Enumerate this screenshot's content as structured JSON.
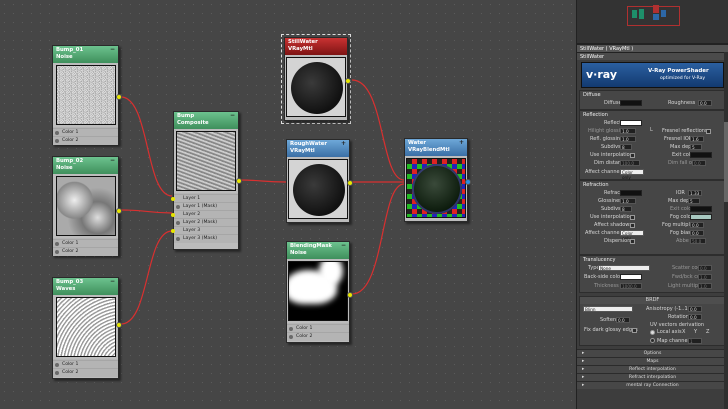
{
  "editor": {
    "nodes": {
      "bump01": {
        "title_line1": "Bump_01",
        "title_line2": "Noise",
        "slots": [
          "Color 1",
          "Color 2"
        ]
      },
      "bump02": {
        "title_line1": "Bump_02",
        "title_line2": "Noise",
        "slots": [
          "Color 1",
          "Color 2"
        ]
      },
      "bump03": {
        "title_line1": "Bump_03",
        "title_line2": "Waves",
        "slots": [
          "Color 1",
          "Color 2"
        ]
      },
      "composite": {
        "title_line1": "Bump",
        "title_line2": "Composite",
        "slots": [
          "Layer 1",
          "Layer 1 (Mask)",
          "Layer 2",
          "Layer 2 (Mask)",
          "Layer 3",
          "Layer 3 (Mask)"
        ]
      },
      "still": {
        "title_line1": "StillWater",
        "title_line2": "VRayMtl"
      },
      "rough": {
        "title_line1": "RoughWater",
        "title_line2": "VRayMtl"
      },
      "mask": {
        "title_line1": "BlendingMask",
        "title_line2": "Noise",
        "slots": [
          "Color 1",
          "Color 2"
        ]
      },
      "water": {
        "title_line1": "Water",
        "title_line2": "VRayBlendMtl"
      }
    },
    "toggle_glyph": "−"
  },
  "panel": {
    "title": "StillWater  ( VRayMtl )",
    "subtitle": "StillWater",
    "vray": {
      "logo": "v·ray",
      "name": "V-Ray PowerShader",
      "tagline": "optimized for V-Ray"
    },
    "diffuse": {
      "header": "Diffuse",
      "diffuse_label": "Diffuse",
      "roughness_label": "Roughness",
      "roughness_value": "0.0"
    },
    "reflection": {
      "header": "Reflection",
      "reflect_label": "Reflect",
      "hilight_label": "Hilight glossiness",
      "hilight_value": "1.0",
      "refl_gloss_label": "Refl. glossiness",
      "refl_gloss_value": "1.0",
      "subdivs_label": "Subdivs",
      "subdivs_value": "8",
      "interp_label": "Use interpolation",
      "dim_dist_label": "Dim distance",
      "dim_dist_value": "100.0",
      "affect_label": "Affect channels",
      "affect_value": "Color only",
      "fresnel_label": "Fresnel reflections",
      "fresnel_ior_label": "Fresnel IOR",
      "fresnel_ior_value": "1.6",
      "max_depth_label": "Max depth",
      "max_depth_value": "5",
      "exit_color_label": "Exit color",
      "dim_falloff_label": "Dim fall off",
      "dim_falloff_value": "0.0",
      "lock_glyph": "L"
    },
    "refraction": {
      "header": "Refraction",
      "refract_label": "Refract",
      "glossiness_label": "Glossiness",
      "glossiness_value": "1.0",
      "subdivs_label": "Subdivs",
      "subdivs_value": "8",
      "interp_label": "Use interpolation",
      "shadows_label": "Affect shadows",
      "affect_label": "Affect channels",
      "affect_value": "Color only",
      "dispersion_label": "Dispersion",
      "ior_label": "IOR",
      "ior_value": "1.33",
      "max_depth_label": "Max depth",
      "max_depth_value": "5",
      "exit_color_label": "Exit color",
      "fog_color_label": "Fog color",
      "fog_mult_label": "Fog multiplier",
      "fog_mult_value": "0.0",
      "fog_bias_label": "Fog bias",
      "fog_bias_value": "0.0",
      "abbe_label": "Abbe",
      "abbe_value": "50.0"
    },
    "translucency": {
      "header": "Translucency",
      "type_label": "Type",
      "type_value": "None",
      "back_color_label": "Back-side color",
      "thickness_label": "Thickness",
      "thickness_value": "1000.0",
      "scatter_label": "Scatter coeff",
      "scatter_value": "0.0",
      "fwdbck_label": "Fwd/bck coeff",
      "fwdbck_value": "1.0",
      "light_mult_label": "Light multiplier",
      "light_mult_value": "1.0"
    },
    "brdf": {
      "header": "BRDF",
      "type_value": "Blinn",
      "anisotropy_label": "Anisotropy (-1..1)",
      "anisotropy_value": "0.0",
      "rotation_label": "Rotation",
      "rotation_value": "0.0",
      "soften_label": "Soften",
      "soften_value": "0.0",
      "dark_edges_label": "Fix dark glossy edges",
      "uv_label": "UV vectors derivation",
      "local_axis_label": "Local axis",
      "axes": [
        "X",
        "Y",
        "Z"
      ],
      "map_channel_label": "Map channel",
      "map_channel_value": "1"
    },
    "rollouts": [
      "Options",
      "Maps",
      "Reflect interpolation",
      "Refract interpolation",
      "mental ray Connection"
    ]
  }
}
